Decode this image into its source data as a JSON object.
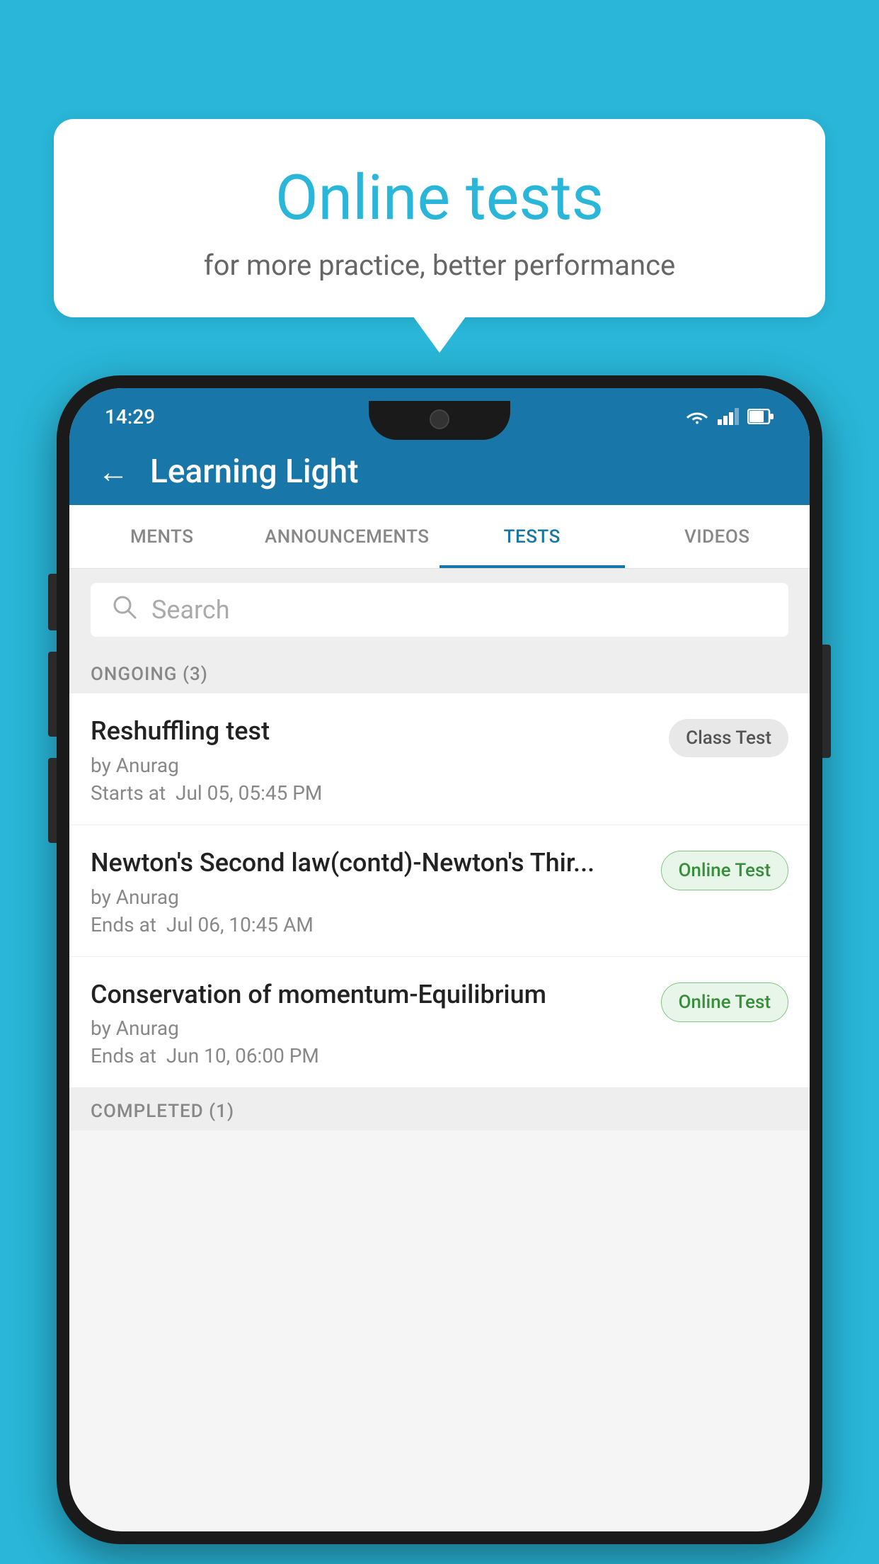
{
  "background": {
    "color": "#29b6d8"
  },
  "speech_bubble": {
    "title": "Online tests",
    "subtitle": "for more practice, better performance"
  },
  "status_bar": {
    "time": "14:29",
    "icons": [
      "wifi",
      "signal",
      "battery"
    ]
  },
  "app_header": {
    "title": "Learning Light",
    "back_label": "←"
  },
  "tabs": [
    {
      "label": "MENTS",
      "active": false
    },
    {
      "label": "ANNOUNCEMENTS",
      "active": false
    },
    {
      "label": "TESTS",
      "active": true
    },
    {
      "label": "VIDEOS",
      "active": false
    }
  ],
  "search": {
    "placeholder": "Search"
  },
  "sections": [
    {
      "label": "ONGOING (3)",
      "tests": [
        {
          "name": "Reshuffling test",
          "by": "by Anurag",
          "date_label": "Starts at",
          "date": "Jul 05, 05:45 PM",
          "badge": "Class Test",
          "badge_type": "class"
        },
        {
          "name": "Newton's Second law(contd)-Newton's Thir...",
          "by": "by Anurag",
          "date_label": "Ends at",
          "date": "Jul 06, 10:45 AM",
          "badge": "Online Test",
          "badge_type": "online"
        },
        {
          "name": "Conservation of momentum-Equilibrium",
          "by": "by Anurag",
          "date_label": "Ends at",
          "date": "Jun 10, 06:00 PM",
          "badge": "Online Test",
          "badge_type": "online"
        }
      ]
    }
  ],
  "completed_section": {
    "label": "COMPLETED (1)"
  }
}
